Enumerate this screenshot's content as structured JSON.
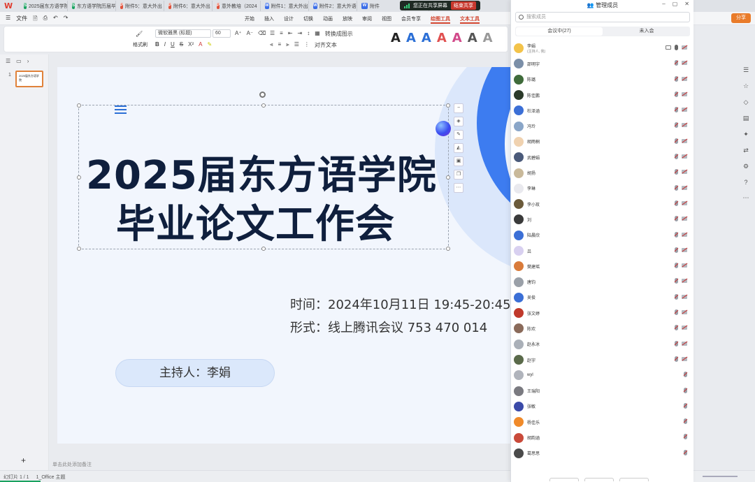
{
  "app": {
    "logo": "W",
    "tabs": [
      {
        "icon": "S",
        "type": "s",
        "label": "2025届东方语学院"
      },
      {
        "icon": "S",
        "type": "s",
        "label": "东方语学院历届毕"
      },
      {
        "icon": "P",
        "type": "pdf",
        "label": "附件5：意大外出"
      },
      {
        "icon": "P",
        "type": "pdf",
        "label": "附件6：意大外出"
      },
      {
        "icon": "P",
        "type": "pdf",
        "label": "意外教培（2024"
      },
      {
        "icon": "W",
        "type": "w",
        "label": "附件1：意大外出"
      },
      {
        "icon": "W",
        "type": "w",
        "label": "附件2：意大外语"
      },
      {
        "icon": "W",
        "type": "w",
        "label": "附件"
      },
      {
        "icon": "P",
        "type": "p",
        "label": "2025届"
      }
    ],
    "sharing_text": "您正在共享屏幕",
    "stop_share_label": "结束共享"
  },
  "menu": {
    "file": "文件",
    "tabs": [
      "开始",
      "插入",
      "设计",
      "切换",
      "动画",
      "放映",
      "审阅",
      "视图",
      "会员专享",
      "绘图工具",
      "文本工具"
    ],
    "active_tab": "文本工具",
    "share_label": "分享"
  },
  "ribbon": {
    "format_painter": "格式刷",
    "font_name": "微软雅黑 (标题)",
    "font_size": "60",
    "text_direction": "转换成图示",
    "align_text": "对齐文本",
    "art_colors": [
      "#222222",
      "#2b6fd6",
      "#2b6fd6",
      "#e05050",
      "#d24a8a",
      "#555555",
      "#999999"
    ]
  },
  "left_panel": {
    "slide_number": "1",
    "thumb_text": "2025届东方语学院"
  },
  "slide": {
    "title_line1": "2025届东方语学院",
    "title_line2": "毕业论文工作会",
    "time_line": "时间：2024年10月11日 19:45-20:45",
    "format_line": "形式：线上腾讯会议 753 470 014",
    "host": "主持人：李娟"
  },
  "status": {
    "notes": "单击此处添加备注",
    "slide_pos": "幻灯片 1 / 1",
    "theme": "1_Office 主题"
  },
  "panel": {
    "title": "管理成员",
    "search_placeholder": "搜索成员",
    "tab_in": "会议中(27)",
    "tab_out": "未入会",
    "members": [
      {
        "name": "李娟",
        "sub": "(主持人, 我)",
        "color": "#f3c34a",
        "host": true
      },
      {
        "name": "邵明宇",
        "color": "#7b8fa8"
      },
      {
        "name": "陈璐",
        "color": "#3f6b3a"
      },
      {
        "name": "陈佳鹏",
        "color": "#2b3a2a"
      },
      {
        "name": "杜泽涵",
        "color": "#3b6fd6"
      },
      {
        "name": "冯玲",
        "color": "#8aa6c8"
      },
      {
        "name": "胡雨桐",
        "color": "#f0d2b0"
      },
      {
        "name": "武碧娟",
        "color": "#4a5a7a"
      },
      {
        "name": "胡扬",
        "color": "#c9b99a"
      },
      {
        "name": "李琳",
        "color": "#e9e9ee"
      },
      {
        "name": "李小玫",
        "color": "#6b5a3a"
      },
      {
        "name": "刘",
        "color": "#3a3a3a"
      },
      {
        "name": "陆晨欣",
        "color": "#3b6fd6"
      },
      {
        "name": "吕",
        "color": "#d8d0f0"
      },
      {
        "name": "樊建瑶",
        "color": "#d97b3a"
      },
      {
        "name": "唐钧",
        "color": "#9aa0a8"
      },
      {
        "name": "吴俊",
        "color": "#3b6fd6"
      },
      {
        "name": "张文婷",
        "color": "#c0392b"
      },
      {
        "name": "陈欢",
        "color": "#8a6a5a"
      },
      {
        "name": "赵永冰",
        "color": "#aab0b8"
      },
      {
        "name": "赵宇",
        "color": "#5a6a4a"
      },
      {
        "name": "wyl",
        "color": "#b0b4bc"
      },
      {
        "name": "王瑞阳",
        "color": "#7a7a80"
      },
      {
        "name": "张敏",
        "color": "#3a4aa8"
      },
      {
        "name": "杨佳乐",
        "color": "#f08a2a"
      },
      {
        "name": "胡韵涵",
        "color": "#c94a3a"
      },
      {
        "name": "葛思思",
        "color": "#4a4a4a"
      }
    ]
  }
}
